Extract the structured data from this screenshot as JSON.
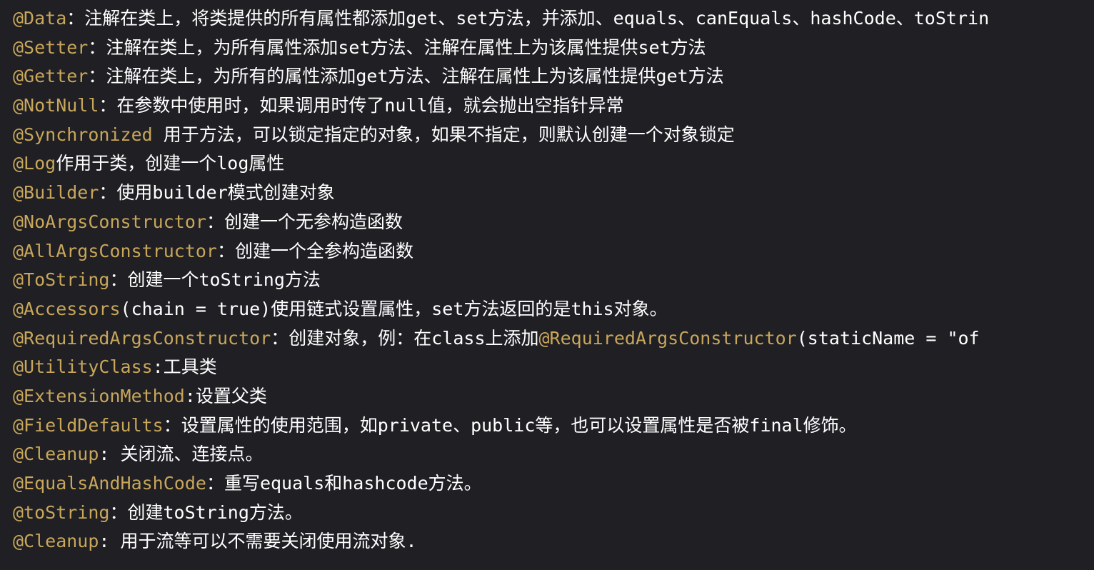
{
  "colors": {
    "background": "#1f1f24",
    "annotation": "#c8a65a",
    "text": "#ffffff"
  },
  "lines": [
    {
      "annotation": "@Data",
      "text": "：注解在类上，将类提供的所有属性都添加get、set方法，并添加、equals、canEquals、hashCode、toStrin"
    },
    {
      "annotation": "@Setter",
      "text": "：注解在类上，为所有属性添加set方法、注解在属性上为该属性提供set方法"
    },
    {
      "annotation": "@Getter",
      "text": "：注解在类上，为所有的属性添加get方法、注解在属性上为该属性提供get方法"
    },
    {
      "annotation": "@NotNull",
      "text": "：在参数中使用时，如果调用时传了null值，就会抛出空指针异常"
    },
    {
      "annotation": "@Synchronized",
      "text": " 用于方法，可以锁定指定的对象，如果不指定，则默认创建一个对象锁定"
    },
    {
      "annotation": "@Log",
      "text": "作用于类，创建一个log属性"
    },
    {
      "annotation": "@Builder",
      "text": "：使用builder模式创建对象"
    },
    {
      "annotation": "@NoArgsConstructor",
      "text": "：创建一个无参构造函数"
    },
    {
      "annotation": "@AllArgsConstructor",
      "text": "：创建一个全参构造函数"
    },
    {
      "annotation": "@ToString",
      "text": "：创建一个toString方法"
    },
    {
      "annotation": "@Accessors",
      "text": "(chain = true)使用链式设置属性，set方法返回的是this对象。"
    },
    {
      "annotation": "@RequiredArgsConstructor",
      "text": "：创建对象，例：在class上添加",
      "annotation2": "@RequiredArgsConstructor",
      "text2": "(staticName = \"of"
    },
    {
      "annotation": "@UtilityClass",
      "text": ":工具类"
    },
    {
      "annotation": "@ExtensionMethod",
      "text": ":设置父类"
    },
    {
      "annotation": "@FieldDefaults",
      "text": "：设置属性的使用范围，如private、public等，也可以设置属性是否被final修饰。"
    },
    {
      "annotation": "@Cleanup",
      "text": ": 关闭流、连接点。"
    },
    {
      "annotation": "@EqualsAndHashCode",
      "text": "：重写equals和hashcode方法。"
    },
    {
      "annotation": "@toString",
      "text": "：创建toString方法。"
    },
    {
      "annotation": "@Cleanup",
      "text": ": 用于流等可以不需要关闭使用流对象."
    }
  ]
}
